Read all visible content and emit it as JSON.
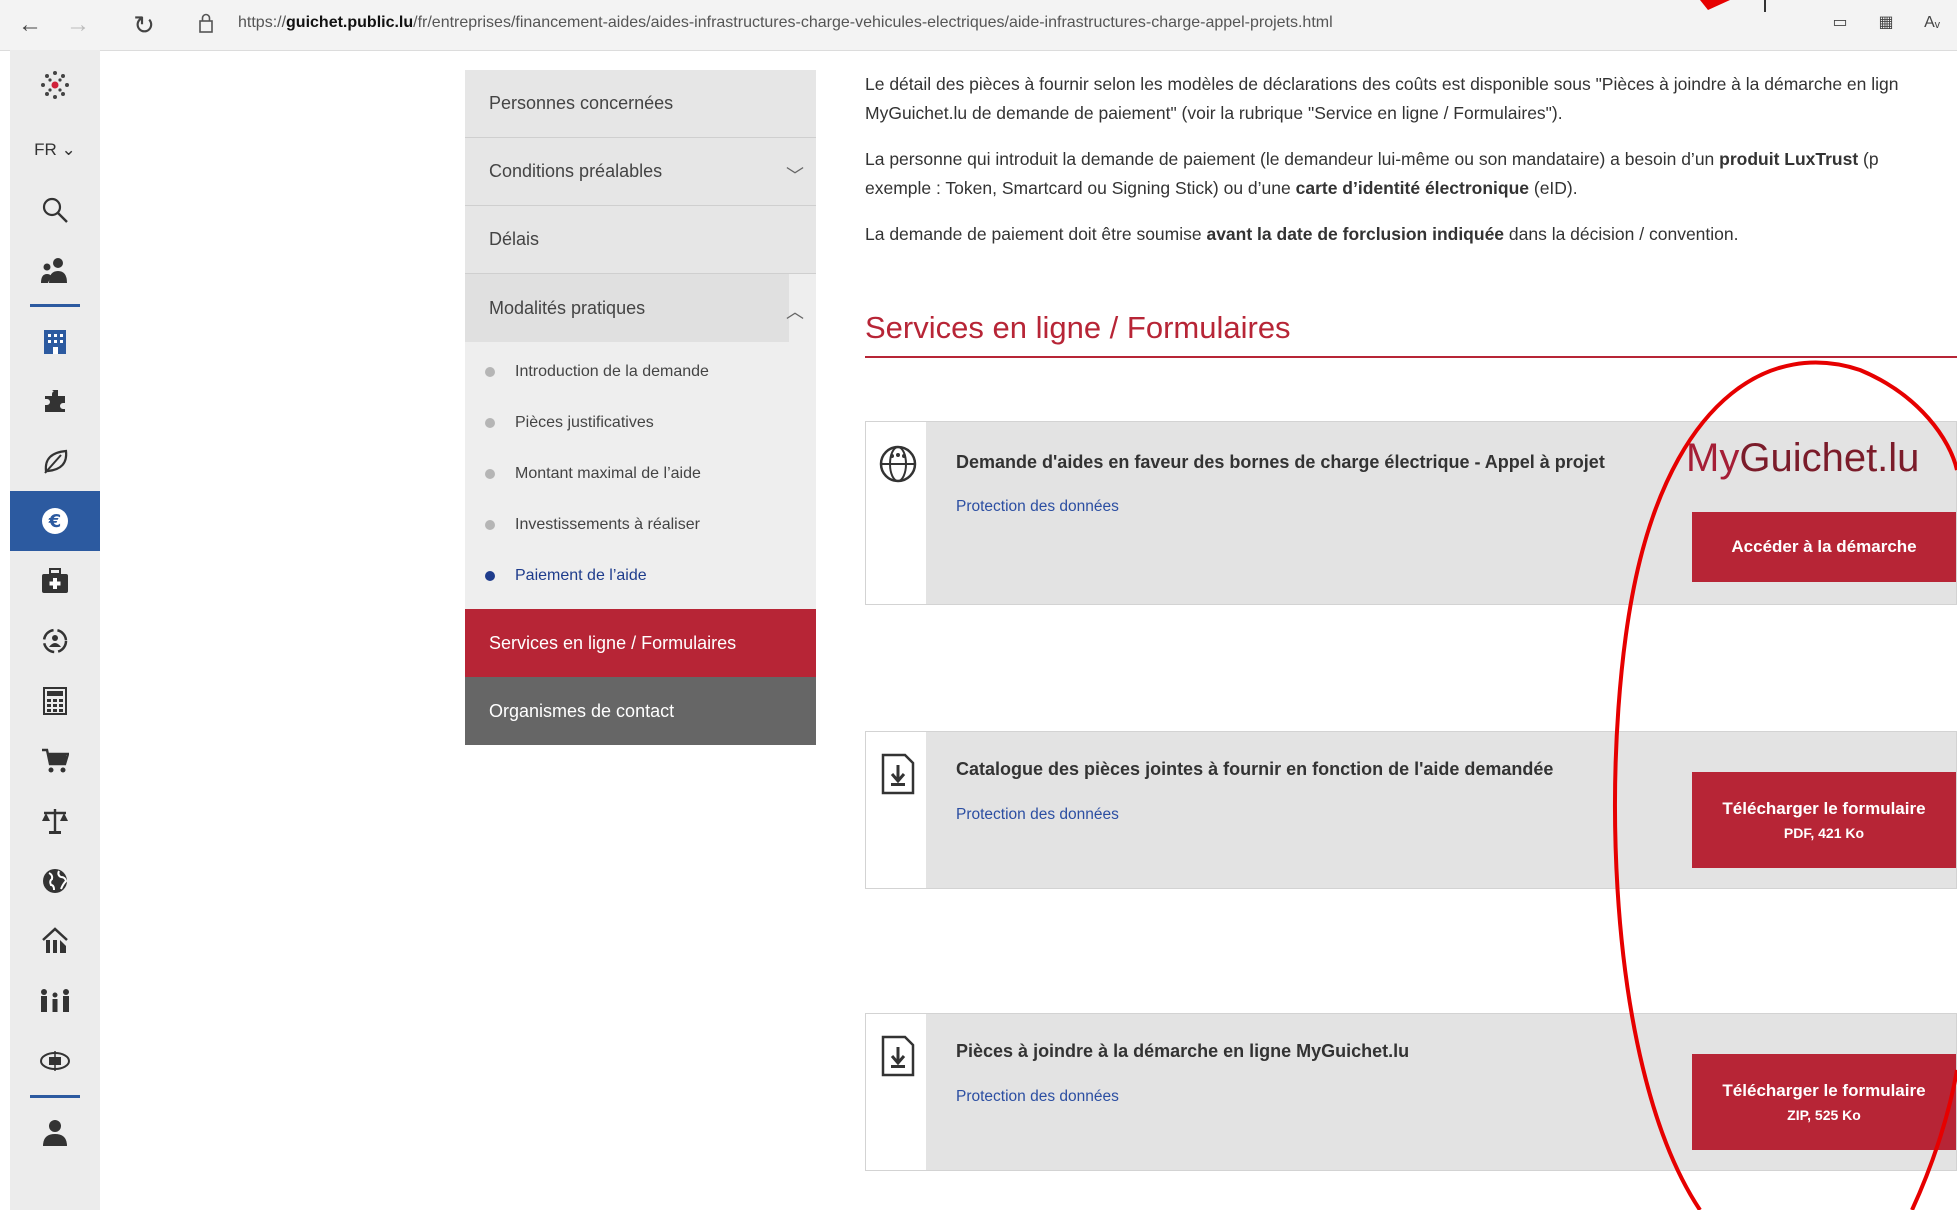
{
  "browser": {
    "url_prefix": "https://",
    "url_domain": "guichet.public.lu",
    "url_path": "/fr/entreprises/financement-aides/aides-infrastructures-charge-vehicules-electriques/aide-infrastructures-charge-appel-projets.html"
  },
  "sidebar": {
    "lang": "FR ⌄"
  },
  "secnav": {
    "items": [
      {
        "label": "Personnes concernées"
      },
      {
        "label": "Conditions préalables"
      },
      {
        "label": "Délais"
      },
      {
        "label": "Modalités pratiques"
      }
    ],
    "subitems": [
      {
        "label": "Introduction de la demande"
      },
      {
        "label": "Pièces justificatives"
      },
      {
        "label": "Montant maximal de l’aide"
      },
      {
        "label": "Investissements à réaliser"
      },
      {
        "label": "Paiement de l’aide"
      }
    ],
    "services": "Services en ligne / Formulaires",
    "contacts": "Organismes de contact"
  },
  "content": {
    "p1a": "Le détail des pièces à fournir selon les modèles de déclarations des coûts est disponible sous \"Pièces à joindre à la démarche en lign",
    "p1b": "MyGuichet.lu de demande de paiement\" (voir la rubrique \"Service en ligne / Formulaires\").",
    "p2a_pre": "La personne qui introduit la demande de paiement (le demandeur lui-même ou son mandataire) a besoin d’un ",
    "p2a_bold": "produit LuxTrust",
    "p2a_post": " (p",
    "p2b_pre": "exemple : Token, Smartcard ou Signing Stick) ou d’une ",
    "p2b_bold": "carte d’identité électronique",
    "p2b_post": " (eID).",
    "p3_pre": "La demande de paiement doit être soumise ",
    "p3_bold": "avant la date de forclusion indiquée",
    "p3_post": " dans la décision / convention."
  },
  "section_title": "Services en ligne / Formulaires",
  "cards": [
    {
      "title": "Demande d'aides en faveur des bornes de charge électrique - Appel à projet",
      "link": "Protection des données",
      "logo_my": "My",
      "logo_rest": "Guichet.lu",
      "button": "Accéder à la démarche"
    },
    {
      "title": "Catalogue des pièces jointes à fournir en fonction de l'aide demandée",
      "link": "Protection des données",
      "button": "Télécharger le formulaire",
      "button_sub": "PDF, 421 Ko"
    },
    {
      "title": "Pièces à joindre à la démarche en ligne MyGuichet.lu",
      "link": "Protection des données",
      "button": "Télécharger le formulaire",
      "button_sub": "ZIP, 525 Ko"
    }
  ],
  "colors": {
    "brand_red": "#b72536",
    "active_blue": "#2c5aa0",
    "link_blue": "#2b4ea2",
    "annotation_red": "#e60000"
  }
}
